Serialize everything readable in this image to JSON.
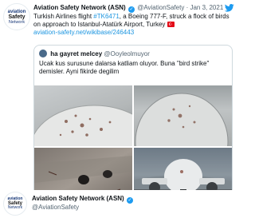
{
  "colors": {
    "link": "#1b95e0",
    "verified": "#1d9bf0",
    "muted": "#536471",
    "text": "#0f1419"
  },
  "avatar": {
    "line1": "aviation",
    "line2": "Safety",
    "line3": "Network"
  },
  "tweet": {
    "name": "Aviation Safety Network (ASN)",
    "handle": "@AviationSafety",
    "separator": "·",
    "date": "Jan 3, 2021",
    "text_part1": "Turkish Airlines flight ",
    "hashtag": "#TK6471",
    "text_part2": ", a Boeing 777-F, struck a flock of birds",
    "text_line2": "on approach to Istanbul-Atatürk Airport, Turkey",
    "link": "aviation-safety.net/wikibase/246443"
  },
  "quote": {
    "name": "ha gayret melcey",
    "handle": "@Ooyleolmuyor",
    "line1": "Ucak kus surusune dalarsa katliam oluyor. Buna \"bird strike\"",
    "line2": "demisler. Ayni fikirde degilim"
  },
  "footer": {
    "name": "Aviation Safety Network (ASN)",
    "handle": "@AviationSafety"
  },
  "icons": {
    "verified": "verified-badge-icon",
    "bird": "twitter-bird-icon",
    "flag": "turkey-flag-icon"
  }
}
